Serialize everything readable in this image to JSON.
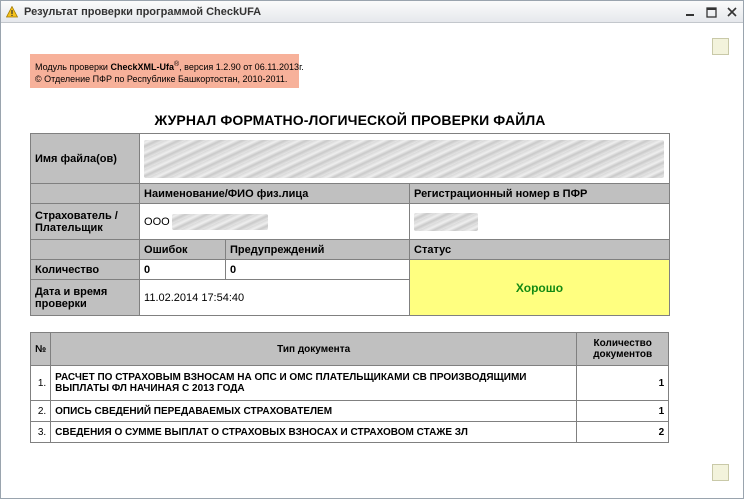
{
  "window": {
    "title": "Результат проверки программой CheckUFA",
    "icons": {
      "app": "warning-triangle-icon",
      "minimize": "minimize-icon",
      "maximize": "maximize-icon",
      "close": "close-icon"
    }
  },
  "module_info": {
    "prefix": "Модуль проверки ",
    "product": "CheckXML-Ufa",
    "registered": "®",
    "version_text": ", версия 1.2.90 от 06.11.2013г.",
    "copyright": "© Отделение ПФР по Республике Башкортостан, 2010-2011."
  },
  "journal_title": "ЖУРНАЛ ФОРМАТНО-ЛОГИЧЕСКОЙ ПРОВЕРКИ ФАЙЛА",
  "info": {
    "file_label": "Имя файла(ов)",
    "name_header": "Наименование/ФИО физ.лица",
    "reg_header": "Регистрационный номер в ПФР",
    "insurer_label": "Страхователь / Плательщик",
    "insurer_prefix": "ООО",
    "errors_header": "Ошибок",
    "warnings_header": "Предупреждений",
    "status_header": "Статус",
    "count_label": "Количество",
    "errors_value": "0",
    "warnings_value": "0",
    "datetime_label": "Дата и время проверки",
    "datetime_value": "11.02.2014 17:54:40",
    "status_value": "Хорошо"
  },
  "docs": {
    "headers": {
      "num": "№",
      "type": "Тип документа",
      "count": "Количество документов"
    },
    "rows": [
      {
        "num": "1.",
        "type": "РАСЧЕТ ПО СТРАХОВЫМ ВЗНОСАМ НА ОПС И ОМС ПЛАТЕЛЬЩИКАМИ СВ ПРОИЗВОДЯЩИМИ ВЫПЛАТЫ ФЛ НАЧИНАЯ С 2013 ГОДА",
        "count": "1"
      },
      {
        "num": "2.",
        "type": "ОПИСЬ СВЕДЕНИЙ ПЕРЕДАВАЕМЫХ СТРАХОВАТЕЛЕМ",
        "count": "1"
      },
      {
        "num": "3.",
        "type": "СВЕДЕНИЯ О СУММЕ ВЫПЛАТ О СТРАХОВЫХ ВЗНОСАХ И СТРАХОВОМ СТАЖЕ ЗЛ",
        "count": "2"
      }
    ]
  }
}
